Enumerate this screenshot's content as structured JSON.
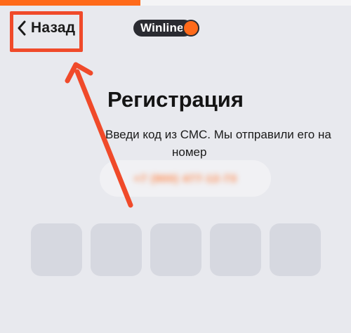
{
  "header": {
    "back_label": "Назад",
    "logo_text": "Winline"
  },
  "progress": {
    "fraction": 0.4
  },
  "main": {
    "title": "Регистрация",
    "subtitle_line1": "Введи код из СМС. Мы отправили его на",
    "subtitle_line2": "номер",
    "phone_masked": "+7 (900) 477-12-73"
  },
  "code_input": {
    "cell_count": 5
  },
  "colors": {
    "accent": "#ff6a1a",
    "annotation": "#f04a2a",
    "background": "#e8e9ee",
    "cell": "#d6d8e0"
  },
  "icons": {
    "back": "chevron-left-icon",
    "annotation_arrow": "arrow-up-left-icon"
  }
}
